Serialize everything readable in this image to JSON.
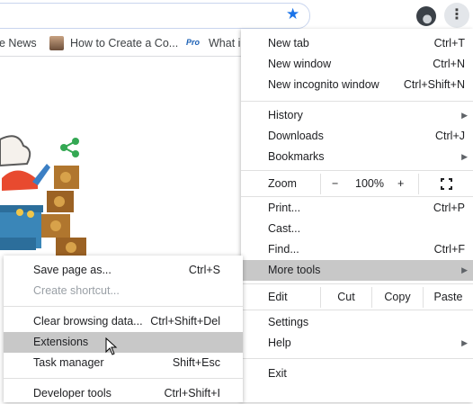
{
  "toolbar": {
    "star_icon": "star-icon",
    "star_color": "#1a73e8",
    "menu_icon": "vertical-dots-icon"
  },
  "bookmarks": [
    {
      "label": "e News"
    },
    {
      "label": "How to Create a Co..."
    },
    {
      "label": "What i",
      "badge": "Pro"
    }
  ],
  "menu": {
    "new_tab": {
      "label": "New tab",
      "shortcut": "Ctrl+T"
    },
    "new_window": {
      "label": "New window",
      "shortcut": "Ctrl+N"
    },
    "incognito": {
      "label": "New incognito window",
      "shortcut": "Ctrl+Shift+N"
    },
    "history": {
      "label": "History"
    },
    "downloads": {
      "label": "Downloads",
      "shortcut": "Ctrl+J"
    },
    "bookmarks": {
      "label": "Bookmarks"
    },
    "zoom": {
      "label": "Zoom",
      "minus": "−",
      "value": "100%",
      "plus": "+",
      "fullscreen_icon": "fullscreen-icon"
    },
    "print": {
      "label": "Print...",
      "shortcut": "Ctrl+P"
    },
    "cast": {
      "label": "Cast..."
    },
    "find": {
      "label": "Find...",
      "shortcut": "Ctrl+F"
    },
    "more_tools": {
      "label": "More tools"
    },
    "edit": {
      "label": "Edit",
      "cut": "Cut",
      "copy": "Copy",
      "paste": "Paste"
    },
    "settings": {
      "label": "Settings"
    },
    "help": {
      "label": "Help"
    },
    "exit": {
      "label": "Exit"
    }
  },
  "more_tools": {
    "save_page": {
      "label": "Save page as...",
      "shortcut": "Ctrl+S"
    },
    "create_shortcut": {
      "label": "Create shortcut..."
    },
    "clear_data": {
      "label": "Clear browsing data...",
      "shortcut": "Ctrl+Shift+Del"
    },
    "extensions": {
      "label": "Extensions"
    },
    "task_manager": {
      "label": "Task manager",
      "shortcut": "Shift+Esc"
    },
    "developer_tools": {
      "label": "Developer tools",
      "shortcut": "Ctrl+Shift+I"
    }
  },
  "colors": {
    "highlight": "#c8c8c8",
    "share_green": "#34a853"
  }
}
